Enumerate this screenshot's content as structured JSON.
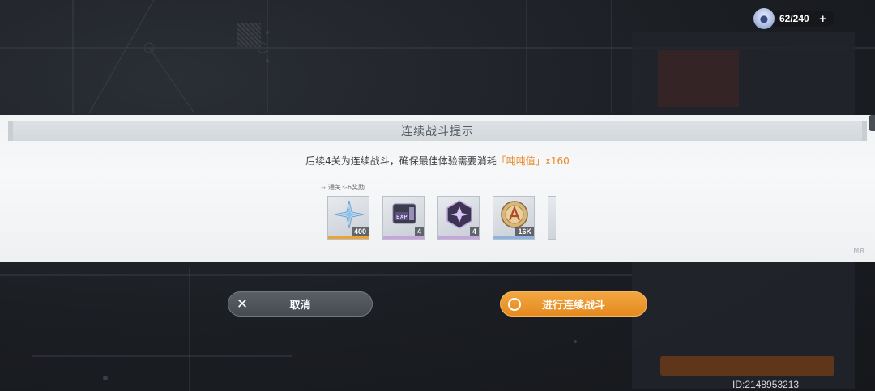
{
  "resource": {
    "icon": "bunny-stamina-icon",
    "value": "62/240",
    "plus_label": "+"
  },
  "dialog": {
    "title": "连续战斗提示",
    "message_prefix": "后续4关为连续战斗，确保最佳体验需要消耗",
    "message_highlight": "「吨吨值」",
    "message_suffix": "x160",
    "reward_label": "通关3-6奖励",
    "rewards": [
      {
        "icon": "crystal-star-icon",
        "count": "400",
        "rarity_color": "#e8a43a"
      },
      {
        "icon": "exp-chip-icon",
        "count": "4",
        "rarity_color": "#c9a3e0"
      },
      {
        "icon": "purple-gem-icon",
        "count": "4",
        "rarity_color": "#c9a3e0"
      },
      {
        "icon": "gold-coin-icon",
        "count": "16K",
        "rarity_color": "#8fb3e0"
      }
    ],
    "watermark": "MR"
  },
  "buttons": {
    "cancel_label": "取消",
    "confirm_label": "进行连续战斗"
  },
  "footer": {
    "id_label": "ID:2148953213"
  },
  "colors": {
    "accent_orange": "#e98a2a",
    "dialog_bg": "#f2f3f5",
    "button_dark": "#4d5259"
  }
}
